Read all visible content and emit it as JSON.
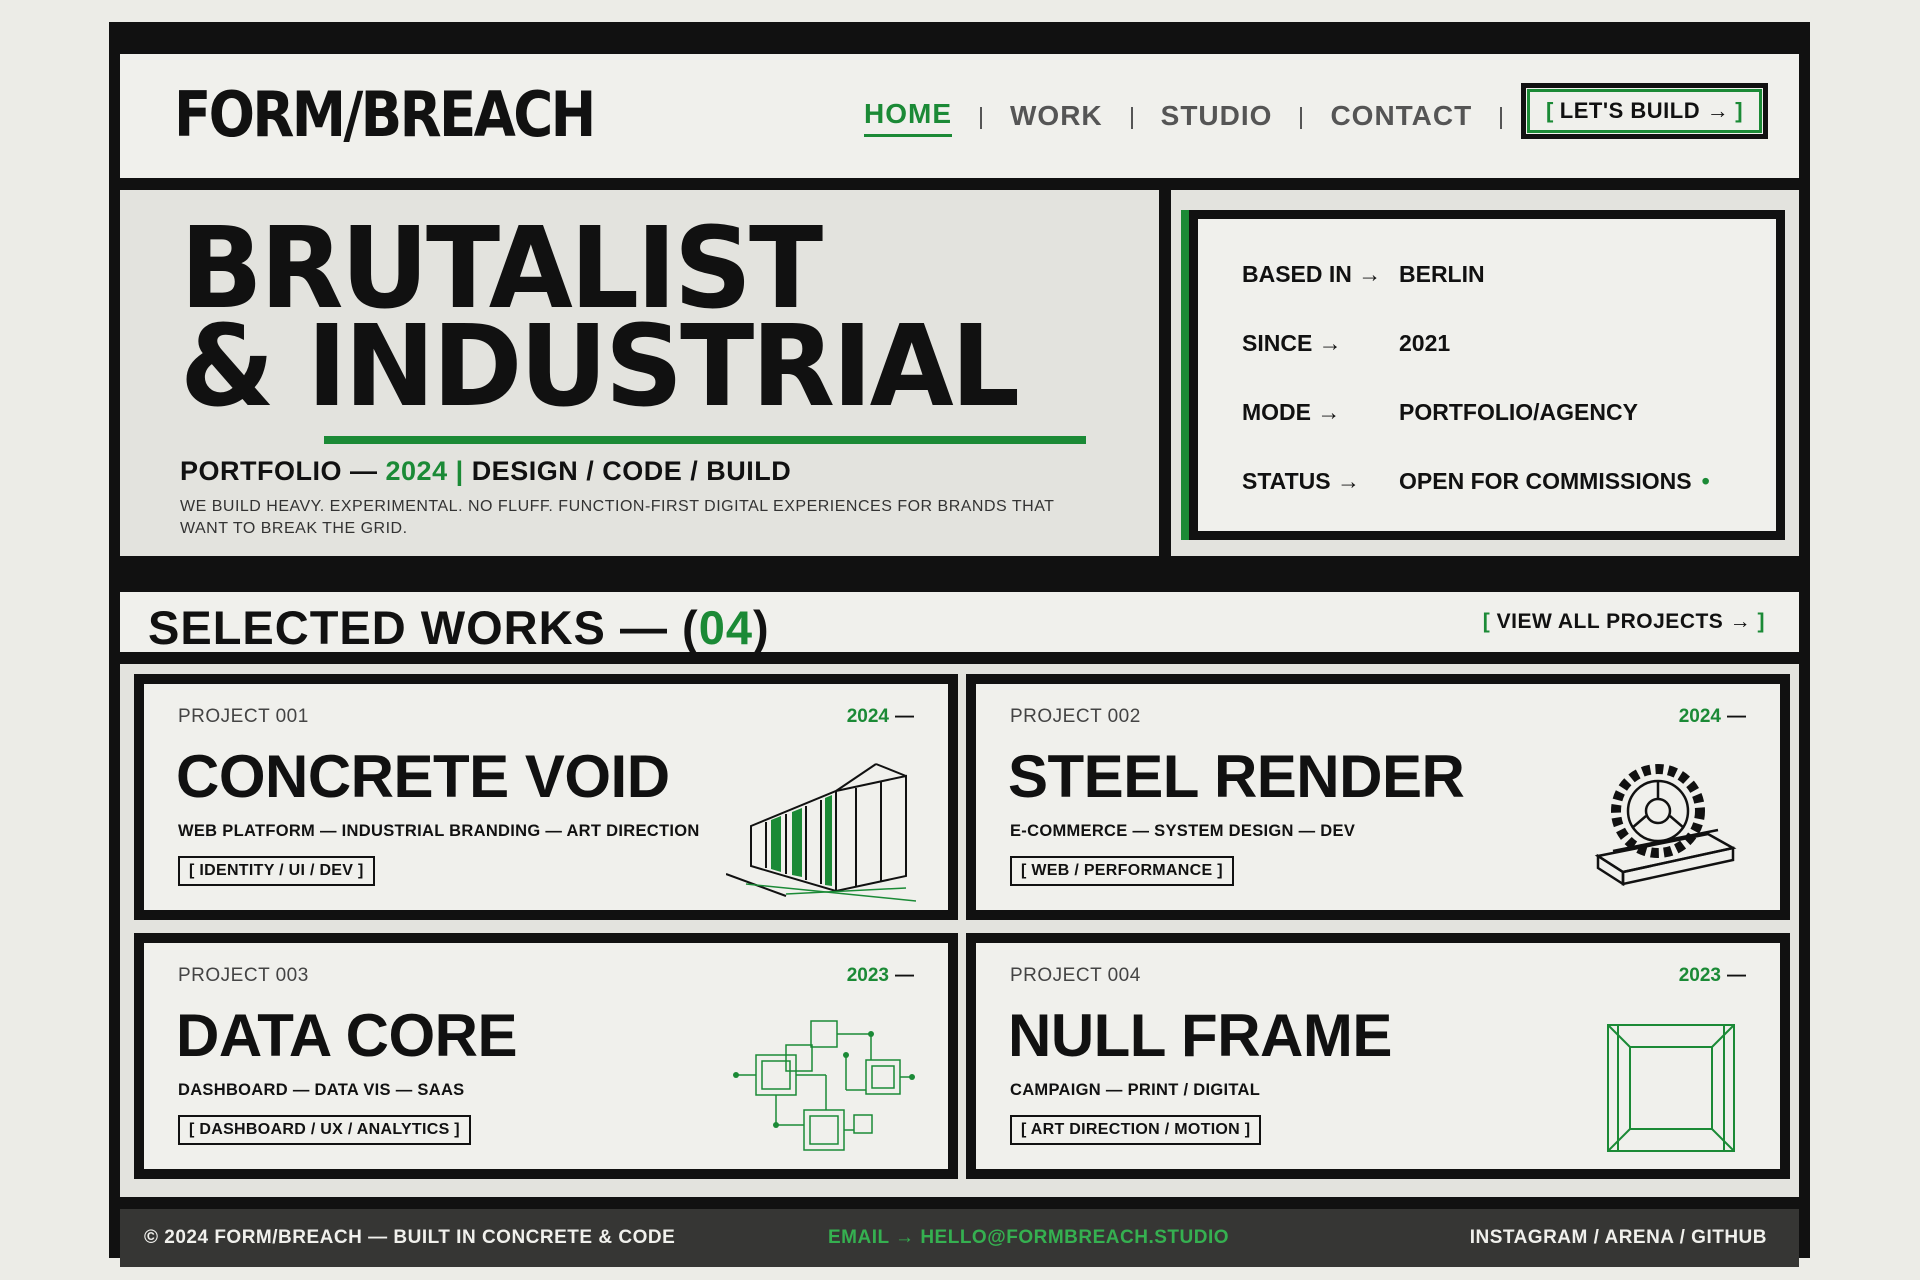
{
  "header": {
    "logo": "FORM/BREACH",
    "nav": [
      {
        "label": "HOME",
        "active": true
      },
      {
        "label": "WORK",
        "active": false
      },
      {
        "label": "STUDIO",
        "active": false
      },
      {
        "label": "CONTACT",
        "active": false
      }
    ],
    "cta": {
      "open": "[",
      "label": "LET'S BUILD →",
      "close": "]"
    }
  },
  "hero": {
    "title_line1": "BRUTALIST",
    "title_line2": "& INDUSTRIAL",
    "sub_prefix": "PORTFOLIO —",
    "sub_year": "2024",
    "sub_sep": "|",
    "sub_rest": "DESIGN / CODE / BUILD",
    "description": "WE BUILD HEAVY. EXPERIMENTAL. NO FLUFF. FUNCTION-FIRST DIGITAL EXPERIENCES FOR BRANDS THAT WANT TO BREAK THE GRID."
  },
  "info": {
    "rows": [
      {
        "key": "BASED IN →",
        "value": "BERLIN"
      },
      {
        "key": "SINCE →",
        "value": "2021"
      },
      {
        "key": "MODE →",
        "value": "PORTFOLIO/AGENCY"
      },
      {
        "key": "STATUS →",
        "value": "OPEN FOR COMMISSIONS"
      }
    ],
    "status_dot": "•"
  },
  "works": {
    "title_prefix": "SELECTED WORKS — (",
    "count": "04",
    "title_suffix": ")",
    "view_all_open": "[",
    "view_all_label": "VIEW ALL PROJECTS →",
    "view_all_close": "]",
    "projects": [
      {
        "number": "PROJECT 001",
        "year": "2024",
        "title": "CONCRETE VOID",
        "desc": "WEB PLATFORM — INDUSTRIAL BRANDING — ART DIRECTION",
        "tag": "[ IDENTITY / UI / DEV ]",
        "icon": "building-wireframe-icon"
      },
      {
        "number": "PROJECT 002",
        "year": "2024",
        "title": "STEEL RENDER",
        "desc": "E-COMMERCE — SYSTEM DESIGN — DEV",
        "tag": "[ WEB / PERFORMANCE ]",
        "icon": "gear-beam-icon"
      },
      {
        "number": "PROJECT 003",
        "year": "2023",
        "title": "DATA CORE",
        "desc": "DASHBOARD — DATA VIS — SAAS",
        "tag": "[ DASHBOARD / UX / ANALYTICS ]",
        "icon": "circuit-grid-icon"
      },
      {
        "number": "PROJECT 004",
        "year": "2023",
        "title": "NULL FRAME",
        "desc": "CAMPAIGN — PRINT / DIGITAL",
        "tag": "[ ART DIRECTION / MOTION ]",
        "icon": "frame-cube-icon"
      }
    ],
    "year_dash": "—"
  },
  "footer": {
    "left": "© 2024 FORM/BREACH — BUILT IN CONCRETE & CODE",
    "email": "EMAIL → HELLO@FORMBREACH.STUDIO",
    "social": "INSTAGRAM / ARENA / GITHUB"
  },
  "colors": {
    "accent": "#1b8a36",
    "ink": "#111111",
    "paper": "#f0f0ec",
    "concrete": "#e3e3de",
    "footer": "#363634"
  }
}
